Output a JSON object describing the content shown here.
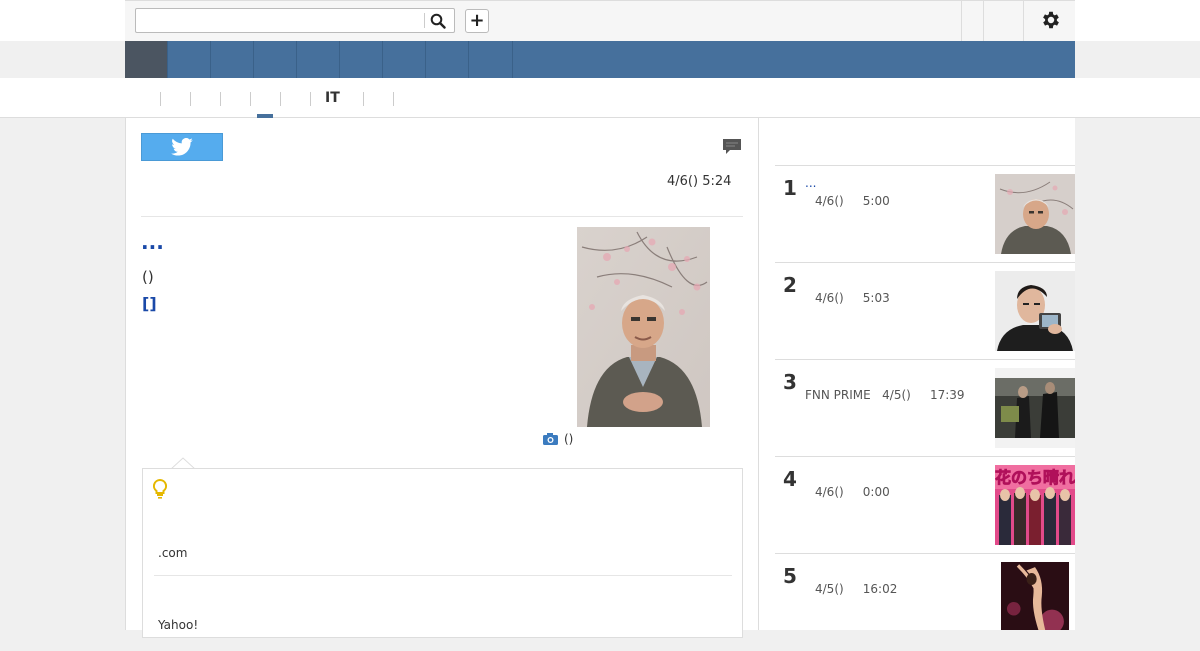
{
  "header": {
    "search": {
      "value": "",
      "placeholder": ""
    },
    "add_label": "+",
    "icons": {
      "search": "search-icon",
      "settings": "gear-icon"
    }
  },
  "subnav": {
    "active_label": "IT"
  },
  "article": {
    "date": "4/6() 5:24",
    "title": "...",
    "source": "()",
    "bracket_link": "[]",
    "photo_caption": "()"
  },
  "tip": {
    "site": ".com",
    "yahoo": "Yahoo!"
  },
  "ranking": [
    {
      "num": "1",
      "title": "...",
      "date": "4/6()",
      "time": "5:00",
      "source": ""
    },
    {
      "num": "2",
      "title": "",
      "date": "4/6()",
      "time": "5:03",
      "source": ""
    },
    {
      "num": "3",
      "title": "",
      "date": "4/5()",
      "time": "17:39",
      "source": "FNN PRIME"
    },
    {
      "num": "4",
      "title": "",
      "date": "4/6()",
      "time": "0:00",
      "source": ""
    },
    {
      "num": "5",
      "title": "",
      "date": "4/5()",
      "time": "16:02",
      "source": ""
    }
  ],
  "thumb4_text": "花のち晴れ",
  "colors": {
    "nav": "#46709c",
    "link": "#1a49a8",
    "twitter": "#55acee"
  }
}
